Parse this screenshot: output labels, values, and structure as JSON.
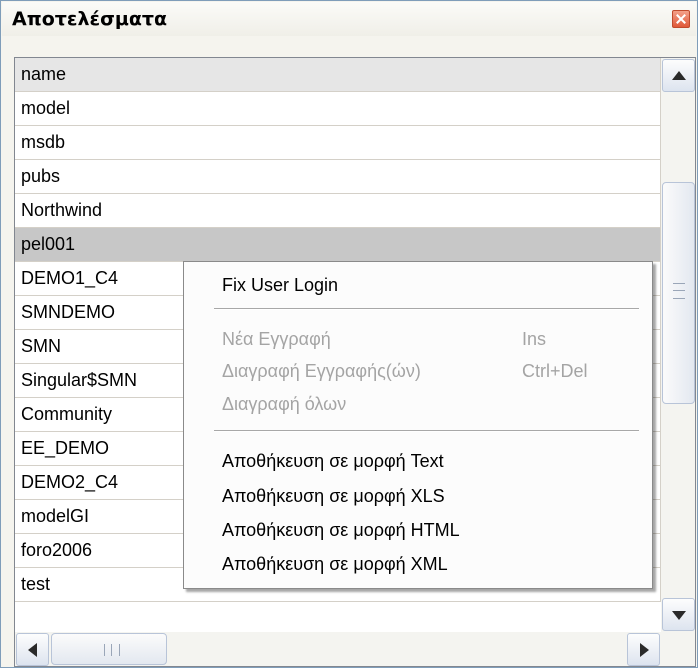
{
  "window": {
    "title": "Αποτελέσματα"
  },
  "list": {
    "header": "name",
    "rows": [
      "model",
      "msdb",
      "pubs",
      "Northwind",
      "pel001",
      "DEMO1_C4",
      "SMNDEMO",
      "SMN",
      "Singular$SMN",
      "Community",
      "EE_DEMO",
      "DEMO2_C4",
      "modelGI",
      "foro2006",
      "test"
    ],
    "selected_row": "pel001"
  },
  "context_menu": {
    "fix_login": "Fix User Login",
    "new_record": "Νέα Εγγραφή",
    "new_record_shortcut": "Ins",
    "delete_records": "Διαγραφή Εγγραφής(ών)",
    "delete_records_shortcut": "Ctrl+Del",
    "delete_all": "Διαγραφή όλων",
    "save_text": "Αποθήκευση σε μορφή Text",
    "save_xls": "Αποθήκευση σε μορφή XLS",
    "save_html": "Αποθήκευση σε μορφή HTML",
    "save_xml": "Αποθήκευση σε μορφή XML"
  },
  "icons": [
    "close-icon",
    "scroll-up-icon",
    "scroll-down-icon",
    "scroll-left-icon",
    "scroll-right-icon"
  ],
  "colors": {
    "close": "#e0593a",
    "selected_row": "#c7c7c7",
    "disabled_text": "#a4a4a4"
  }
}
